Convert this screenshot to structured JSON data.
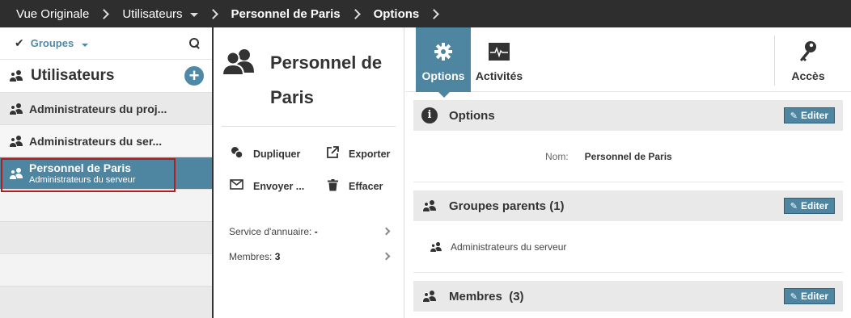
{
  "breadcrumb": [
    "Vue Originale",
    "Utilisateurs",
    "Personnel de Paris",
    "Options"
  ],
  "sidebar": {
    "groups_label": "Groupes",
    "title": "Utilisateurs",
    "items": [
      {
        "label": "Administrateurs du proj..."
      },
      {
        "label": "Administrateurs du ser..."
      }
    ],
    "selected": {
      "name": "Personnel de Paris",
      "sub": "Administrateurs du serveur"
    }
  },
  "middle": {
    "title": "Personnel de Paris",
    "actions": {
      "duplicate": "Dupliquer",
      "export": "Exporter",
      "send": "Envoyer ...",
      "delete": "Effacer"
    },
    "directory_label": "Service d'annuaire:",
    "directory_value": "-",
    "members_label": "Membres:",
    "members_value": "3"
  },
  "toolbar": {
    "options": "Options",
    "activities": "Activités",
    "access": "Accès"
  },
  "sections": {
    "options": {
      "title": "Options",
      "edit": "Editer",
      "name_key": "Nom:",
      "name_value": "Personnel de Paris"
    },
    "parents": {
      "title": "Groupes parents (1)",
      "edit": "Editer",
      "item": "Administrateurs du serveur"
    },
    "members": {
      "title": "Membres  (3)",
      "edit": "Editer"
    }
  },
  "colors": {
    "accent": "#4e86a2",
    "topbar": "#2e2e2e",
    "selection_outline": "#b01e1e"
  }
}
